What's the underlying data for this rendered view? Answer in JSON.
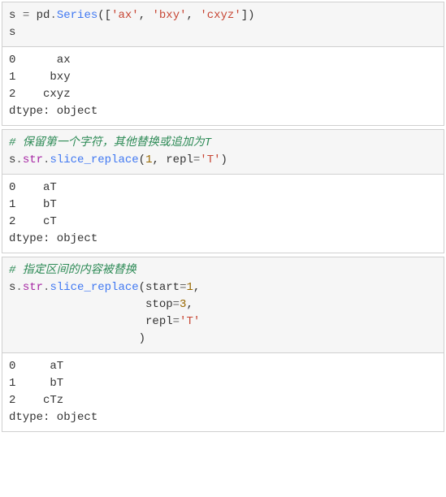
{
  "cells": [
    {
      "code_tokens": [
        {
          "t": "s ",
          "c": "tok-id"
        },
        {
          "t": "=",
          "c": "tok-op"
        },
        {
          "t": " pd",
          "c": "tok-id"
        },
        {
          "t": ".",
          "c": "tok-op"
        },
        {
          "t": "Series",
          "c": "tok-method"
        },
        {
          "t": "([",
          "c": "tok-paren"
        },
        {
          "t": "'ax'",
          "c": "tok-str"
        },
        {
          "t": ", ",
          "c": "tok-paren"
        },
        {
          "t": "'bxy'",
          "c": "tok-str"
        },
        {
          "t": ", ",
          "c": "tok-paren"
        },
        {
          "t": "'cxyz'",
          "c": "tok-str"
        },
        {
          "t": "])",
          "c": "tok-paren"
        },
        {
          "t": "\n",
          "c": ""
        },
        {
          "t": "s",
          "c": "tok-id"
        }
      ],
      "output": "0      ax\n1     bxy\n2    cxyz\ndtype: object"
    },
    {
      "code_tokens": [
        {
          "t": "# 保留第一个字符，其他替换或追加为T",
          "c": "tok-comment"
        },
        {
          "t": "\n",
          "c": ""
        },
        {
          "t": "s",
          "c": "tok-id"
        },
        {
          "t": ".",
          "c": "tok-op"
        },
        {
          "t": "str",
          "c": "tok-kw"
        },
        {
          "t": ".",
          "c": "tok-op"
        },
        {
          "t": "slice_replace",
          "c": "tok-method"
        },
        {
          "t": "(",
          "c": "tok-paren"
        },
        {
          "t": "1",
          "c": "tok-num"
        },
        {
          "t": ", repl",
          "c": "tok-id"
        },
        {
          "t": "=",
          "c": "tok-op"
        },
        {
          "t": "'T'",
          "c": "tok-str"
        },
        {
          "t": ")",
          "c": "tok-paren"
        }
      ],
      "output": "0    aT\n1    bT\n2    cT\ndtype: object"
    },
    {
      "code_tokens": [
        {
          "t": "# 指定区间的内容被替换",
          "c": "tok-comment"
        },
        {
          "t": "\n",
          "c": ""
        },
        {
          "t": "s",
          "c": "tok-id"
        },
        {
          "t": ".",
          "c": "tok-op"
        },
        {
          "t": "str",
          "c": "tok-kw"
        },
        {
          "t": ".",
          "c": "tok-op"
        },
        {
          "t": "slice_replace",
          "c": "tok-method"
        },
        {
          "t": "(start",
          "c": "tok-id"
        },
        {
          "t": "=",
          "c": "tok-op"
        },
        {
          "t": "1",
          "c": "tok-num"
        },
        {
          "t": ",",
          "c": "tok-paren"
        },
        {
          "t": "\n                    stop",
          "c": "tok-id"
        },
        {
          "t": "=",
          "c": "tok-op"
        },
        {
          "t": "3",
          "c": "tok-num"
        },
        {
          "t": ",",
          "c": "tok-paren"
        },
        {
          "t": "\n                    repl",
          "c": "tok-id"
        },
        {
          "t": "=",
          "c": "tok-op"
        },
        {
          "t": "'T'",
          "c": "tok-str"
        },
        {
          "t": "\n                   )",
          "c": "tok-paren"
        }
      ],
      "output": "0     aT\n1     bT\n2    cTz\ndtype: object"
    }
  ]
}
